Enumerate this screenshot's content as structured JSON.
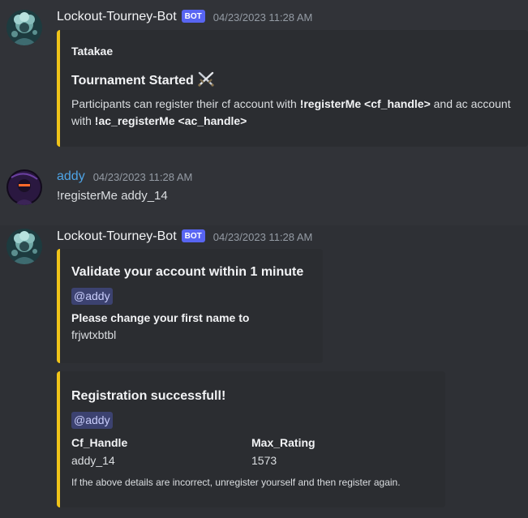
{
  "messages": [
    {
      "username": "Lockout-Tourney-Bot",
      "bot_tag": "BOT",
      "timestamp": "04/23/2023 11:28 AM",
      "embed": {
        "author": "Tatakae",
        "title": "Tournament Started",
        "title_icon": "crossed-swords-icon",
        "desc_part1": "Participants can register their cf account with ",
        "desc_cmd1": "!registerMe <cf_handle>",
        "desc_part2": " and ac account with ",
        "desc_cmd2": "!ac_registerMe <ac_handle>"
      }
    },
    {
      "username": "addy",
      "timestamp": "04/23/2023 11:28 AM",
      "content": "!registerMe addy_14"
    },
    {
      "username": "Lockout-Tourney-Bot",
      "bot_tag": "BOT",
      "timestamp": "04/23/2023 11:28 AM",
      "embed": {
        "title": "Validate your account within 1 minute",
        "mention": "@addy",
        "field_name": "Please change your first name to",
        "field_value": "frjwtxbtbl"
      }
    },
    {
      "embed": {
        "title": "Registration successfull!",
        "mention": "@addy",
        "fields": [
          {
            "name": "Cf_Handle",
            "value": "addy_14"
          },
          {
            "name": "Max_Rating",
            "value": "1573"
          }
        ],
        "footer": "If the above details are incorrect, unregister yourself and then register again."
      }
    }
  ],
  "colors": {
    "background": "#313338",
    "embed_background": "#2b2d31",
    "embed_accent": "#f0c419",
    "bot_tag": "#5865f2",
    "username_addy": "#4ea4e6",
    "mention_bg": "#3c4270"
  }
}
